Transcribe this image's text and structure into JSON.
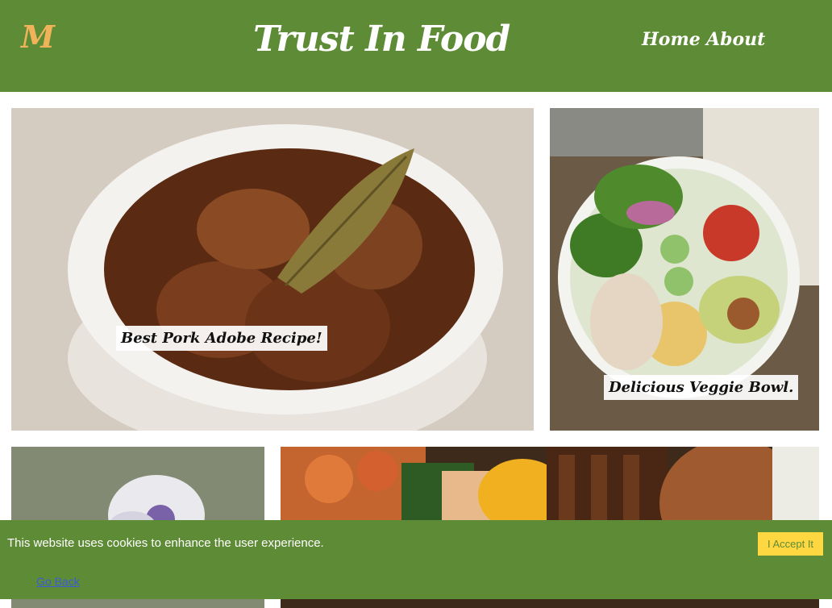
{
  "header": {
    "logo": "M",
    "title": "Trust In Food",
    "nav": [
      {
        "label": "Home"
      },
      {
        "label": "About"
      }
    ]
  },
  "cards": [
    {
      "caption": "Best Pork Adobe Recipe!"
    },
    {
      "caption": "Delicious Veggie Bowl."
    },
    {
      "caption": ""
    },
    {
      "caption": ""
    }
  ],
  "cookie": {
    "message": "This website uses cookies to enhance the user experience.",
    "accept_label": "I Accept It",
    "back_label": "Go Back"
  },
  "colors": {
    "brand_green": "#5e8b35",
    "logo_orange": "#f0b35a",
    "accept_yellow": "#ffd740"
  }
}
